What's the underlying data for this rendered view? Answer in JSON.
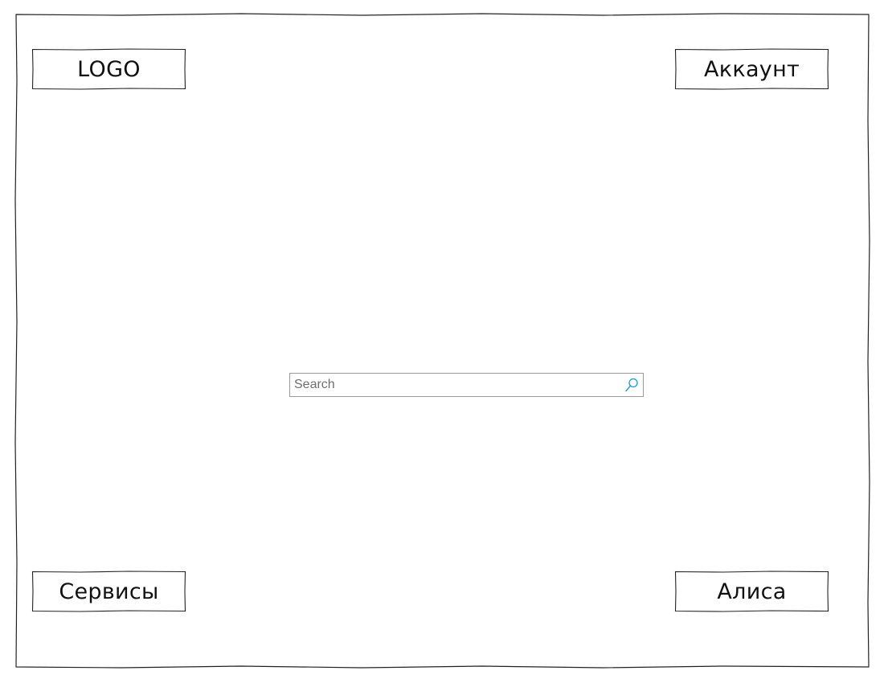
{
  "header": {
    "logo_label": "LOGO",
    "account_label": "Аккаунт"
  },
  "search": {
    "placeholder": "Search",
    "icon": "search-icon",
    "icon_color": "#1a9ad6"
  },
  "footer": {
    "services_label": "Сервисы",
    "alice_label": "Алиса"
  }
}
